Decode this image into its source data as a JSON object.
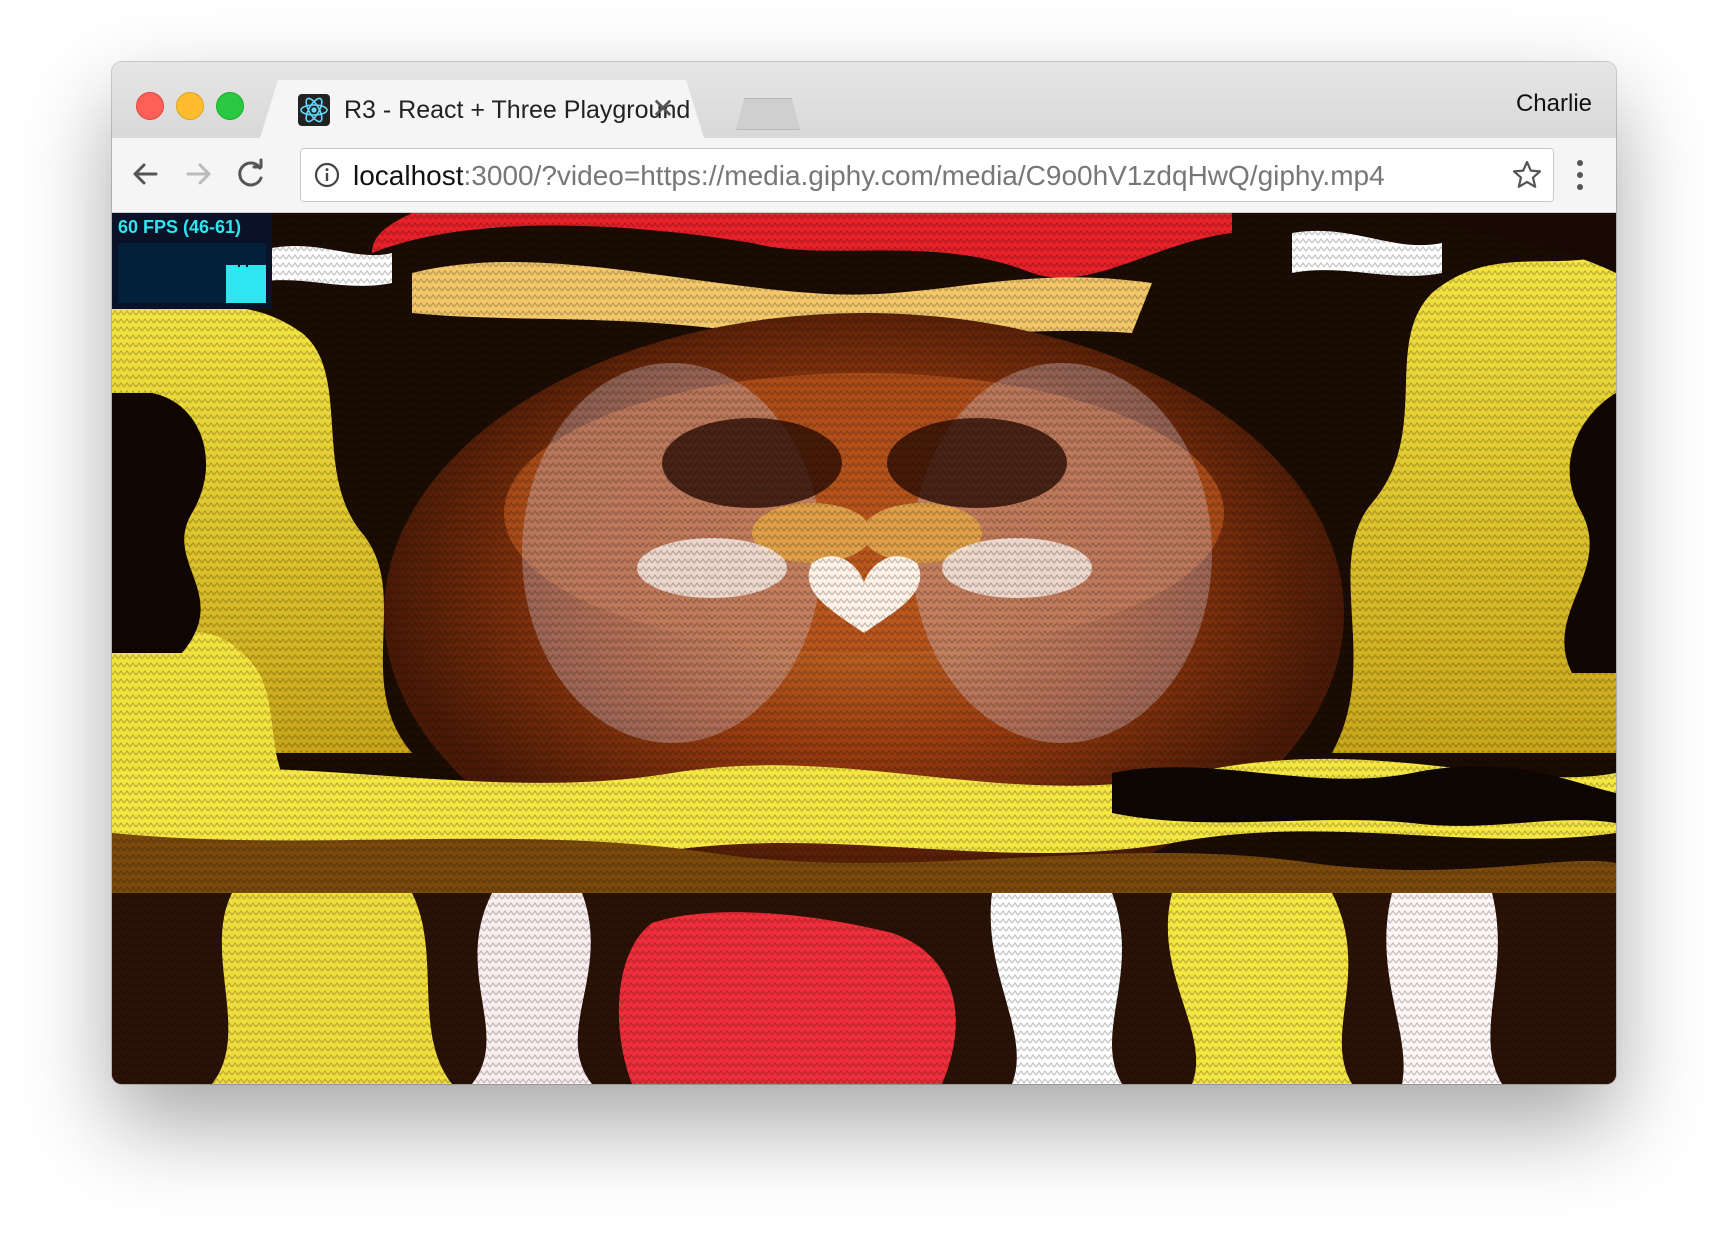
{
  "window": {
    "profile_name": "Charlie"
  },
  "tab": {
    "title": "R3 - React + Three Playground",
    "close_glyph": "✕",
    "favicon": "react-atom-icon"
  },
  "toolbar": {
    "back_icon": "back-arrow-icon",
    "forward_icon": "forward-arrow-icon",
    "reload_icon": "reload-icon",
    "info_icon": "info-icon",
    "bookmark_icon": "star-icon",
    "menu_icon": "kebab-menu-icon"
  },
  "omnibox": {
    "host": "localhost",
    "rest": ":3000/?video=https://media.giphy.com/media/C9o0hV1zdqHwQ/giphy.mp4"
  },
  "stats": {
    "fps_label": "60 FPS (46-61)",
    "fps_value": 60,
    "fps_min": 46,
    "fps_max": 61,
    "text_color": "#2ee6f0"
  },
  "content": {
    "description_color_accent": [
      "#f5e642",
      "#e8202a",
      "#8b3a12",
      "#ffffff"
    ]
  }
}
